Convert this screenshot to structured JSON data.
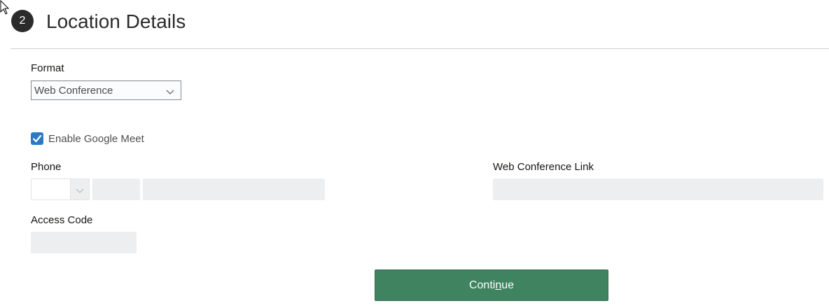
{
  "step": {
    "number": "2",
    "title": "Location Details"
  },
  "format": {
    "label": "Format",
    "selected": "Web Conference"
  },
  "google_meet": {
    "label": "Enable Google Meet",
    "checked": true
  },
  "phone": {
    "label": "Phone",
    "country_code": "",
    "area_code": "",
    "number": ""
  },
  "web_conference_link": {
    "label": "Web Conference Link",
    "value": ""
  },
  "access_code": {
    "label": "Access Code",
    "value": ""
  },
  "continue_button": {
    "label_prefix": "Conti",
    "label_mnemonic": "n",
    "label_suffix": "ue"
  },
  "colors": {
    "primary_button": "#3f8361",
    "checkbox": "#2a7ac4",
    "input_fill": "#edeeef"
  },
  "icons": {
    "cursor": "mouse-pointer-icon",
    "dropdown": "chevron-down-icon",
    "check": "checkmark-icon"
  }
}
